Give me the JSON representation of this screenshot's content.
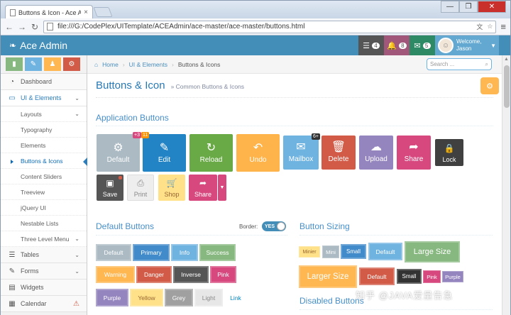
{
  "browser": {
    "tab_title": "Buttons & Icon - Ace Ad",
    "url": "file:///G:/CodePlex/UITemplate/ACEAdmin/ace-master/ace-master/buttons.html",
    "close": "×",
    "min": "—",
    "max": "❐",
    "win_close": "✕"
  },
  "navbar": {
    "brand": "Ace Admin",
    "tasks_count": "4",
    "notif_count": "8",
    "msg_count": "5",
    "welcome": "Welcome,",
    "user": "Jason"
  },
  "sidebar": {
    "items": [
      {
        "label": "Dashboard",
        "icon": "tachometer-icon"
      },
      {
        "label": "UI & Elements",
        "icon": "desktop-icon"
      }
    ],
    "sub": [
      {
        "label": "Layouts"
      },
      {
        "label": "Typography"
      },
      {
        "label": "Elements"
      },
      {
        "label": "Buttons & Icons"
      },
      {
        "label": "Content Sliders"
      },
      {
        "label": "Treeview"
      },
      {
        "label": "jQuery UI"
      },
      {
        "label": "Nestable Lists"
      },
      {
        "label": "Three Level Menu"
      }
    ],
    "bottom": [
      {
        "label": "Tables"
      },
      {
        "label": "Forms"
      },
      {
        "label": "Widgets"
      },
      {
        "label": "Calendar"
      }
    ]
  },
  "breadcrumbs": {
    "home": "Home",
    "ui": "UI & Elements",
    "current": "Buttons & Icons",
    "search_placeholder": "Search ..."
  },
  "page": {
    "title": "Buttons & Icon",
    "subtitle": "» Common Buttons & Icons"
  },
  "app_buttons": {
    "section": "Application Buttons",
    "row1": [
      {
        "label": "Default",
        "icon": "gear-icon",
        "badge": "+3"
      },
      {
        "label": "Edit",
        "icon": "edit-icon",
        "badge": "11"
      },
      {
        "label": "Reload",
        "icon": "refresh-icon"
      },
      {
        "label": "Undo",
        "icon": "undo-icon"
      },
      {
        "label": "Mailbox",
        "icon": "envelope-icon",
        "badge": "6+"
      },
      {
        "label": "Delete",
        "icon": "trash-icon"
      },
      {
        "label": "Upload",
        "icon": "cloud-upload-icon"
      },
      {
        "label": "Share",
        "icon": "share-icon"
      },
      {
        "label": "Lock",
        "icon": "lock-icon"
      }
    ],
    "row2": [
      {
        "label": "Save",
        "icon": "floppy-icon"
      },
      {
        "label": "Print",
        "icon": "print-icon"
      },
      {
        "label": "Shop",
        "icon": "cart-icon"
      },
      {
        "label": "Share",
        "icon": "share-icon"
      }
    ]
  },
  "default_buttons": {
    "section": "Default Buttons",
    "border_label": "Border:",
    "toggle": "YES",
    "labels": [
      "Default",
      "Primary",
      "Info",
      "Success",
      "Warning",
      "Danger",
      "Inverse",
      "Pink",
      "Purple",
      "Yellow",
      "Grey",
      "Light",
      "Link"
    ]
  },
  "button_sizing": {
    "section": "Button Sizing",
    "labels": [
      "Minier",
      "Mini",
      "Small",
      "Default",
      "Large Size",
      "Larger Size",
      "Default",
      "Small",
      "Pink",
      "Purple"
    ]
  },
  "disabled": {
    "section": "Disabled Buttons"
  },
  "watermark": "知乎 @JAVA爱量告急"
}
